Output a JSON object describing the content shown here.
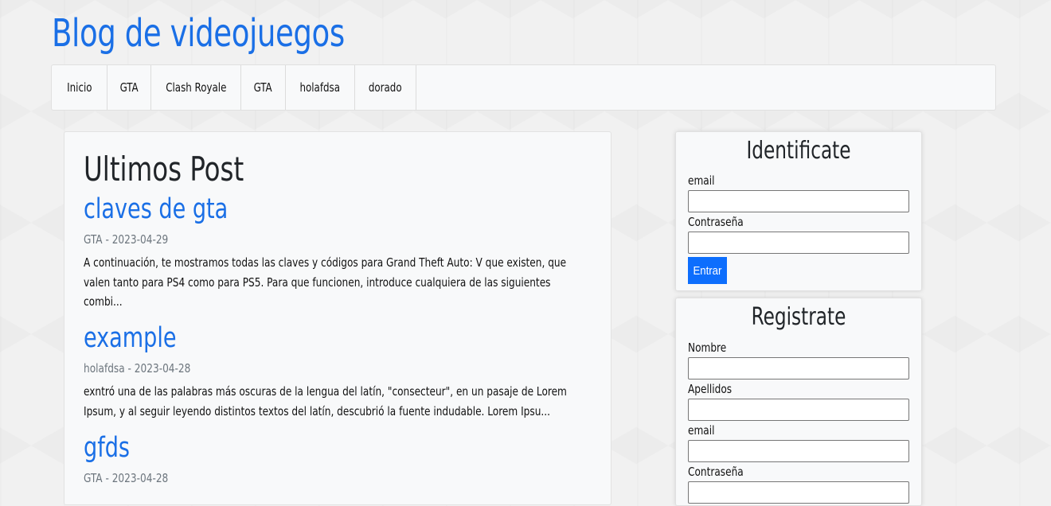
{
  "site": {
    "title": "Blog de videojuegos"
  },
  "nav": {
    "items": [
      {
        "label": "Inicio"
      },
      {
        "label": "GTA"
      },
      {
        "label": "Clash Royale"
      },
      {
        "label": "GTA"
      },
      {
        "label": "holafdsa"
      },
      {
        "label": "dorado"
      }
    ]
  },
  "posts": {
    "heading": "Ultimos Post",
    "items": [
      {
        "title": "claves de gta",
        "meta": "GTA - 2023-04-29",
        "excerpt": "A continuación, te mostramos todas las claves y códigos para Grand Theft Auto: V que existen, que valen tanto para PS4 como para PS5. Para que funcionen, introduce cualquiera de las siguientes combi..."
      },
      {
        "title": "example",
        "meta": "holafdsa - 2023-04-28",
        "excerpt": "exntró una de las palabras más oscuras de la lengua del latín, \"consecteur\", en un pasaje de Lorem Ipsum, y al seguir leyendo distintos textos del latín, descubrió la fuente indudable. Lorem Ipsu..."
      },
      {
        "title": "gfds",
        "meta": "GTA - 2023-04-28",
        "excerpt": ""
      }
    ]
  },
  "login": {
    "title": "Identificate",
    "email_label": "email",
    "password_label": "Contraseña",
    "email_value": "",
    "password_value": "",
    "submit_label": "Entrar"
  },
  "register": {
    "title": "Registrate",
    "nombre_label": "Nombre",
    "apellidos_label": "Apellidos",
    "email_label": "email",
    "password_label": "Contraseña",
    "nombre_value": "",
    "apellidos_value": "",
    "email_value": "",
    "password_value": ""
  },
  "colors": {
    "brand": "#1a6fe6",
    "button": "#0d6efd",
    "meta": "#6c757d"
  }
}
